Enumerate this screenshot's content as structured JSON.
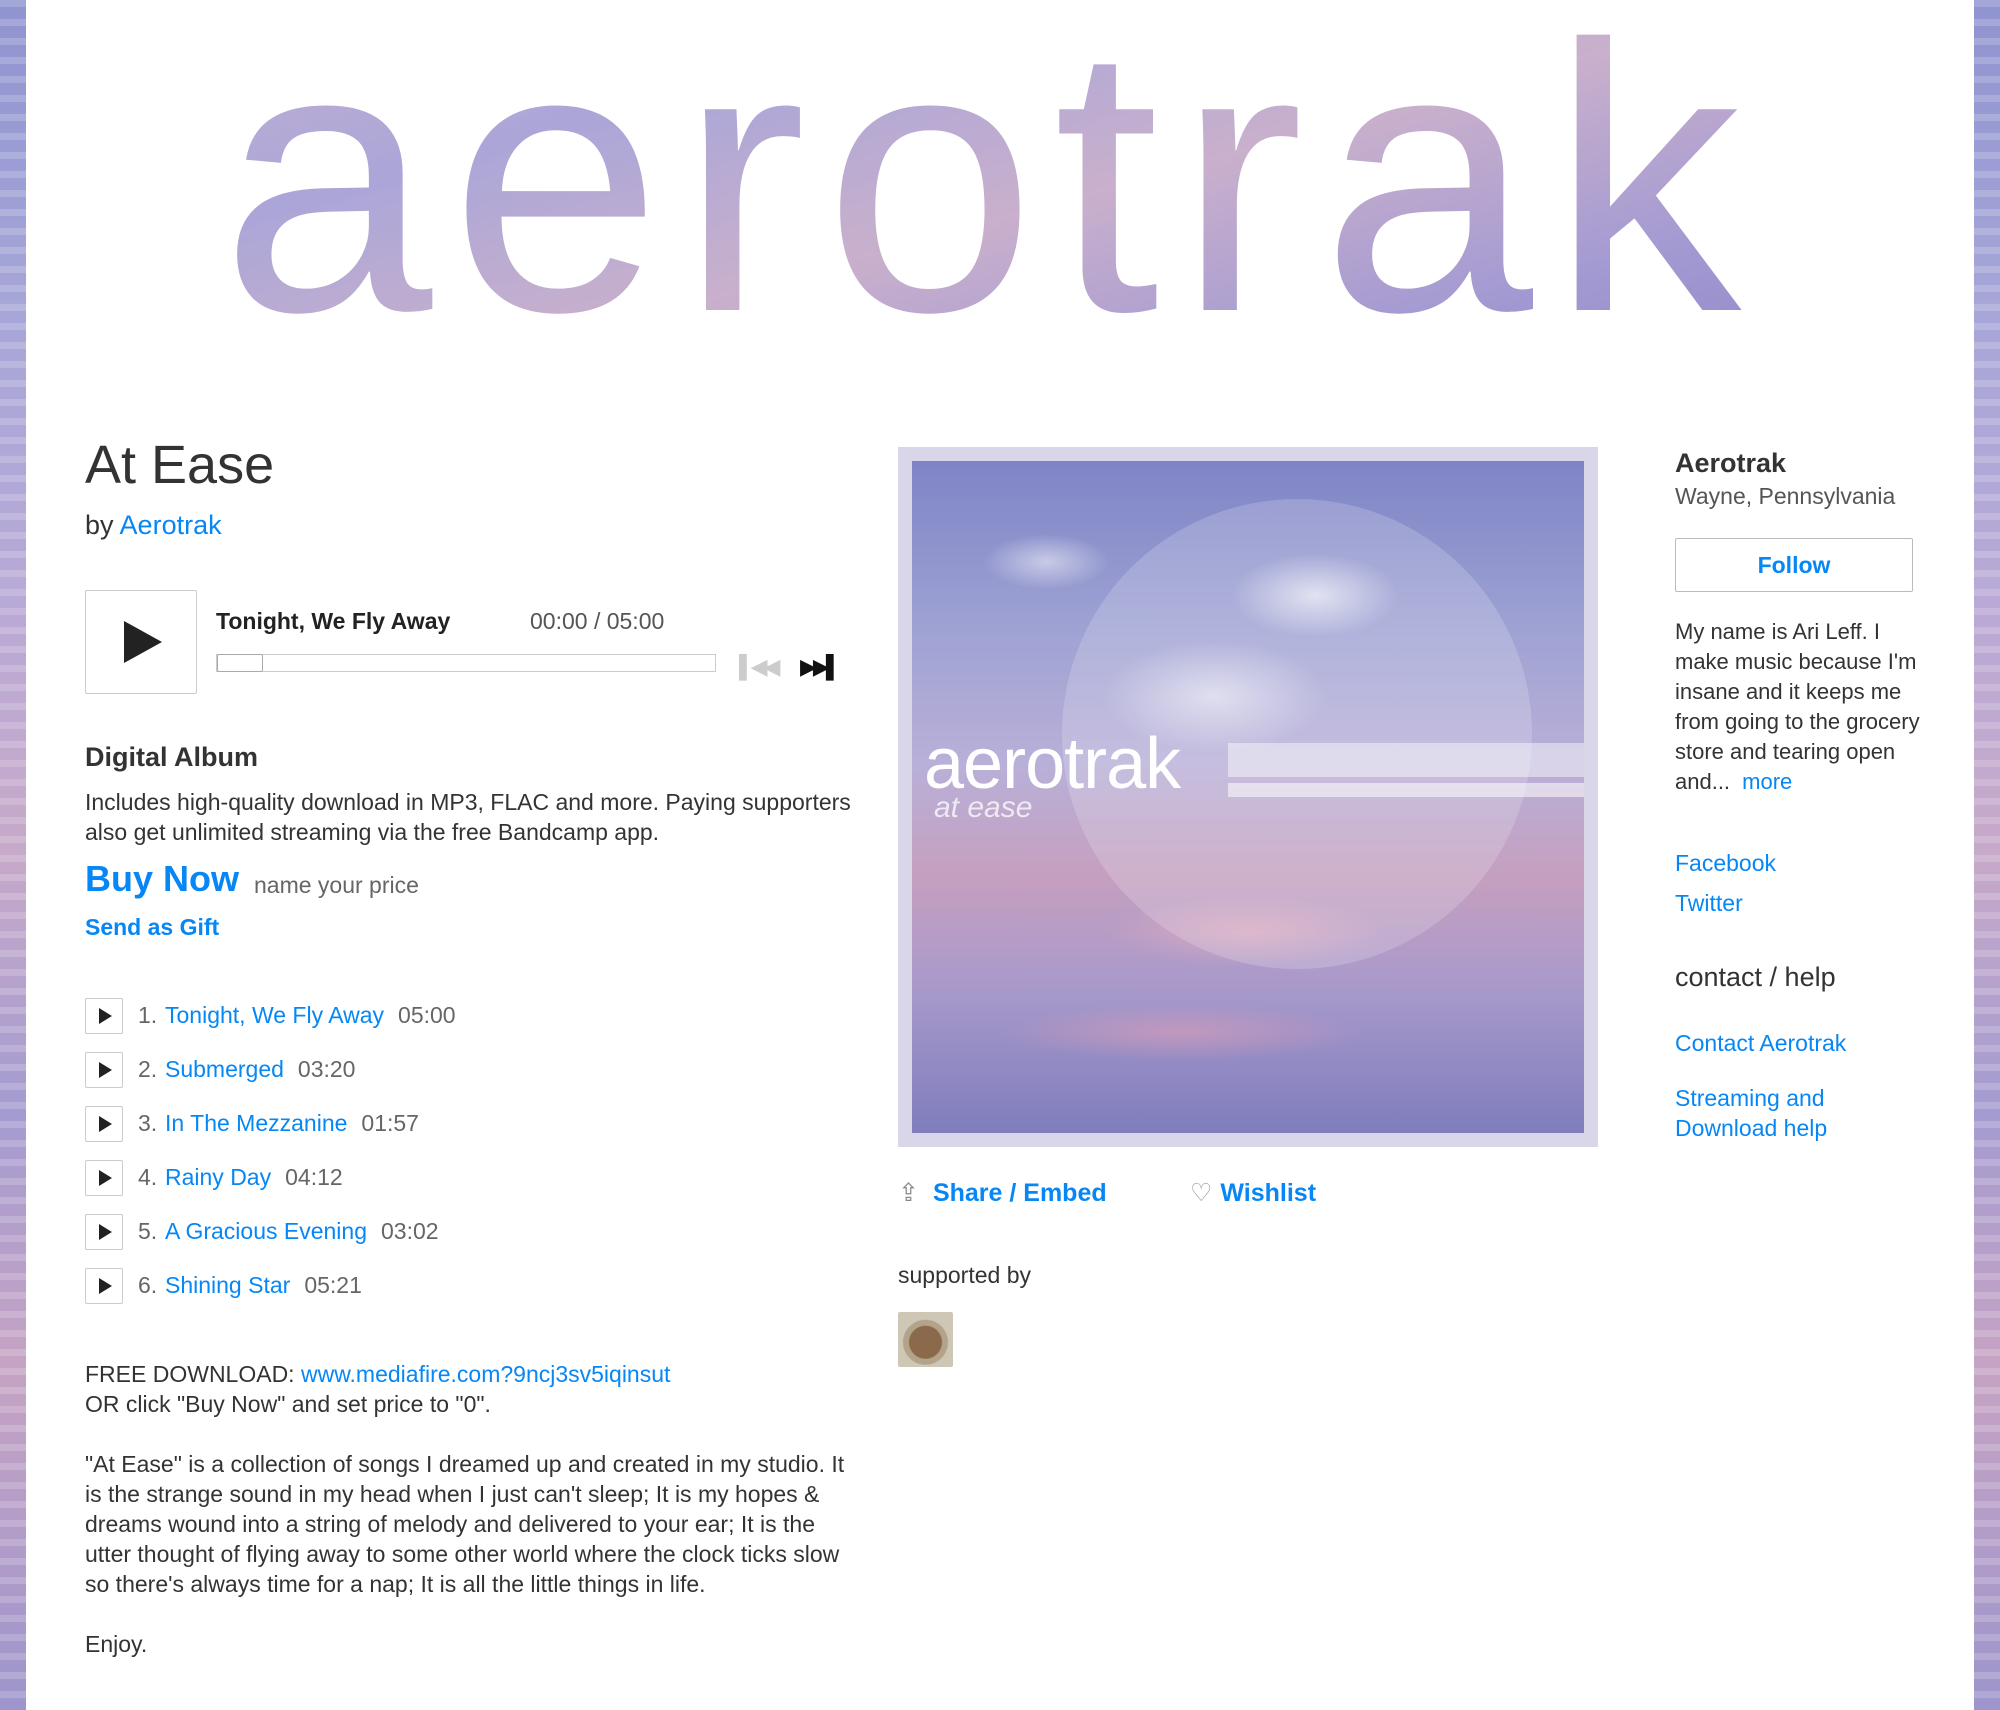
{
  "banner": {
    "text": "aerotrak"
  },
  "album": {
    "title": "At Ease",
    "by_prefix": "by",
    "artist": "Aerotrak"
  },
  "player": {
    "track_title": "Tonight, We Fly Away",
    "time": "00:00 / 05:00"
  },
  "digital": {
    "title": "Digital Album",
    "description": "Includes high-quality download in MP3, FLAC and more. Paying supporters also get unlimited streaming via the free Bandcamp app.",
    "buy_label": "Buy Now",
    "price_label": "name your price",
    "gift_label": "Send as Gift"
  },
  "tracks": [
    {
      "num": "1.",
      "name": "Tonight, We Fly Away",
      "duration": "05:00"
    },
    {
      "num": "2.",
      "name": "Submerged",
      "duration": "03:20"
    },
    {
      "num": "3.",
      "name": "In The Mezzanine",
      "duration": "01:57"
    },
    {
      "num": "4.",
      "name": "Rainy Day",
      "duration": "04:12"
    },
    {
      "num": "5.",
      "name": "A Gracious Evening",
      "duration": "03:02"
    },
    {
      "num": "6.",
      "name": "Shining Star",
      "duration": "05:21"
    }
  ],
  "about": {
    "download_prefix": "FREE DOWNLOAD:",
    "download_link": "www.mediafire.com?9ncj3sv5iqinsut",
    "download_note": "OR click \"Buy Now\" and set price to \"0\".",
    "paragraph": "\"At Ease\" is a collection of songs I dreamed up and created in my studio. It is the strange sound in my head when I just can't sleep; It is my hopes & dreams wound into a string of melody and delivered to your ear; It is the utter thought of flying away to some other world where the clock ticks slow so there's always time for a nap; It is all the little things in life.",
    "closing": "Enjoy."
  },
  "cover": {
    "artist": "aerotrak",
    "album": "at ease"
  },
  "actions": {
    "share_label": "Share / Embed",
    "wishlist_label": "Wishlist",
    "share_icon": "share-icon",
    "wishlist_icon": "heart-icon"
  },
  "supported": {
    "label": "supported by"
  },
  "sidebar": {
    "band_name": "Aerotrak",
    "location": "Wayne, Pennsylvania",
    "follow_label": "Follow",
    "bio": "My name is Ari Leff. I make music because I'm insane and it keeps me from going to the grocery store and tearing open and...",
    "more_label": "more",
    "facebook": "Facebook",
    "twitter": "Twitter",
    "contact_heading": "contact / help",
    "contact_link": "Contact Aerotrak",
    "help_link": "Streaming and Download help"
  },
  "colors": {
    "link": "#0687f5",
    "text": "#333333"
  }
}
